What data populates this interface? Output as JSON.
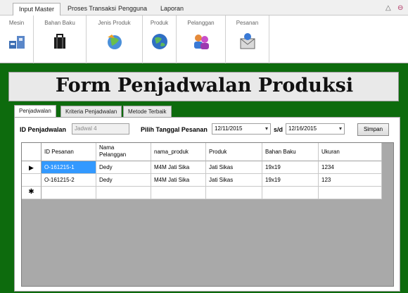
{
  "ribbon": {
    "tabs": [
      "Input Master",
      "Proses Transaksi",
      "Pengguna",
      "Laporan"
    ],
    "buttons": [
      {
        "label": "Mesin",
        "icon": "machine-icon"
      },
      {
        "label": "Bahan Baku",
        "icon": "material-box-icon"
      },
      {
        "label": "Jenis Produk",
        "icon": "product-type-icon"
      },
      {
        "label": "Produk",
        "icon": "product-globe-icon"
      },
      {
        "label": "Pelanggan",
        "icon": "customers-icon"
      },
      {
        "label": "Pesanan",
        "icon": "order-mail-icon"
      }
    ]
  },
  "window_controls": {
    "collapse": "△",
    "minimize": "⊖"
  },
  "form": {
    "title": "Form Penjadwalan Produksi",
    "tabs": [
      "Penjadwalan",
      "Kriteria Penjadwalan",
      "Metode Terbaik"
    ],
    "id_label": "ID Penjadwalan",
    "id_value": "Jadwal 4",
    "date_label": "Pilih Tanggal Pesanan",
    "date_from": "12/11/2015",
    "sd_label": "s/d",
    "date_to": "12/16/2015",
    "save_label": "Simpan"
  },
  "grid": {
    "columns": [
      "ID Pesanan",
      "Nama\nPelanggan",
      "nama_produk",
      "Produk",
      "Bahan Baku",
      "Ukuran"
    ],
    "rows": [
      [
        "O-161215-1",
        "Dedy",
        "M4M Jati Sika",
        "Jati Sikas",
        "19x19",
        "1234"
      ],
      [
        "O-161215-2",
        "Dedy",
        "M4M Jati Sika",
        "Jati Sikas",
        "19x19",
        "123"
      ]
    ],
    "current_row_marker": "▶",
    "new_row_marker": "✱"
  },
  "colors": {
    "background": "#0d6b0d",
    "selection": "#3399ff",
    "grid_empty": "#a9a9a9"
  }
}
